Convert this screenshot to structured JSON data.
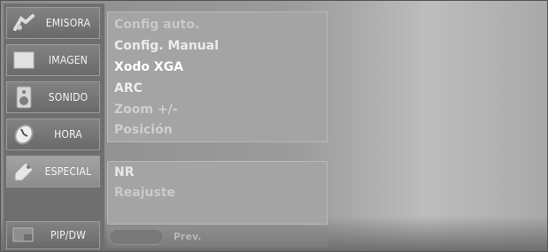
{
  "sidebar": {
    "items": [
      {
        "label": "EMISORA",
        "icon": "satellite-icon"
      },
      {
        "label": "IMAGEN",
        "icon": "picture-icon"
      },
      {
        "label": "SONIDO",
        "icon": "speaker-icon"
      },
      {
        "label": "HORA",
        "icon": "clock-icon"
      },
      {
        "label": "ESPECIAL",
        "icon": "tag-icon"
      },
      {
        "label": "PIP/DW",
        "icon": "pip-icon"
      }
    ],
    "active": "ESPECIAL"
  },
  "menu": {
    "group1": [
      {
        "label": "Config auto.",
        "state": "dimmed"
      },
      {
        "label": "Config. Manual",
        "state": "normal"
      },
      {
        "label": "Xodo XGA",
        "state": "highlighted"
      },
      {
        "label": "ARC",
        "state": "normal"
      },
      {
        "label": "Zoom +/-",
        "state": "dimmed"
      },
      {
        "label": "Posición",
        "state": "dimmed"
      }
    ],
    "group2": [
      {
        "label": "NR",
        "state": "normal"
      },
      {
        "label": "Reajuste",
        "state": "dimmed"
      }
    ]
  },
  "footer": {
    "label": "Prev."
  },
  "colors": {
    "text_highlight": "#ffffff",
    "text_normal": "#ececec",
    "text_dimmed": "#c9c9c9"
  }
}
